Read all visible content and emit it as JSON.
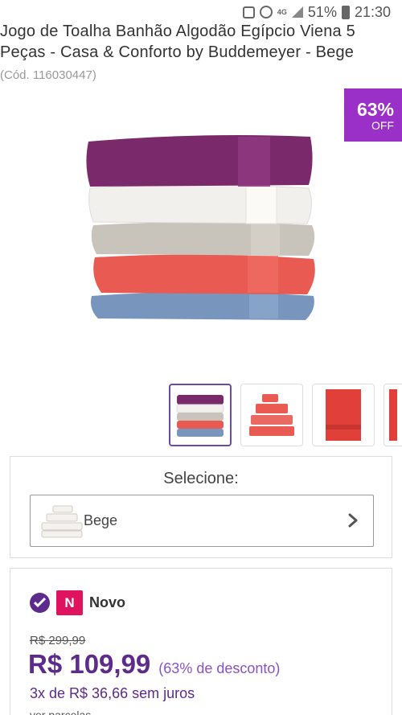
{
  "status_bar": {
    "network": "4G",
    "battery": "51%",
    "time": "21:30"
  },
  "product": {
    "title": "Jogo de Toalha Banhão Algodão Egípcio Viena 5 Peças - Casa & Conforto by Buddemeyer - Bege",
    "code": "(Cód. 116030447)",
    "badge_percent": "63%",
    "badge_off": "OFF"
  },
  "colors": {
    "brand_purple": "#5d2b8c",
    "badge_purple": "#9b30c9",
    "new_badge": "#e0145e",
    "towel_plum": "#7a2a6b",
    "towel_white": "#f1f0ec",
    "towel_grey": "#c8c3bb",
    "towel_coral": "#e85a52",
    "towel_blue": "#7896bd"
  },
  "variant_select": {
    "label": "Selecione:",
    "value": "Bege",
    "chevron_icon": "chevron-right-icon"
  },
  "offer": {
    "condition": "Novo",
    "condition_badge": "N",
    "old_price": "R$ 299,99",
    "price": "R$ 109,99",
    "discount": "(63% de desconto)",
    "installments": "3x de R$ 36,66 sem juros",
    "more_plans": "ver parcelas"
  }
}
